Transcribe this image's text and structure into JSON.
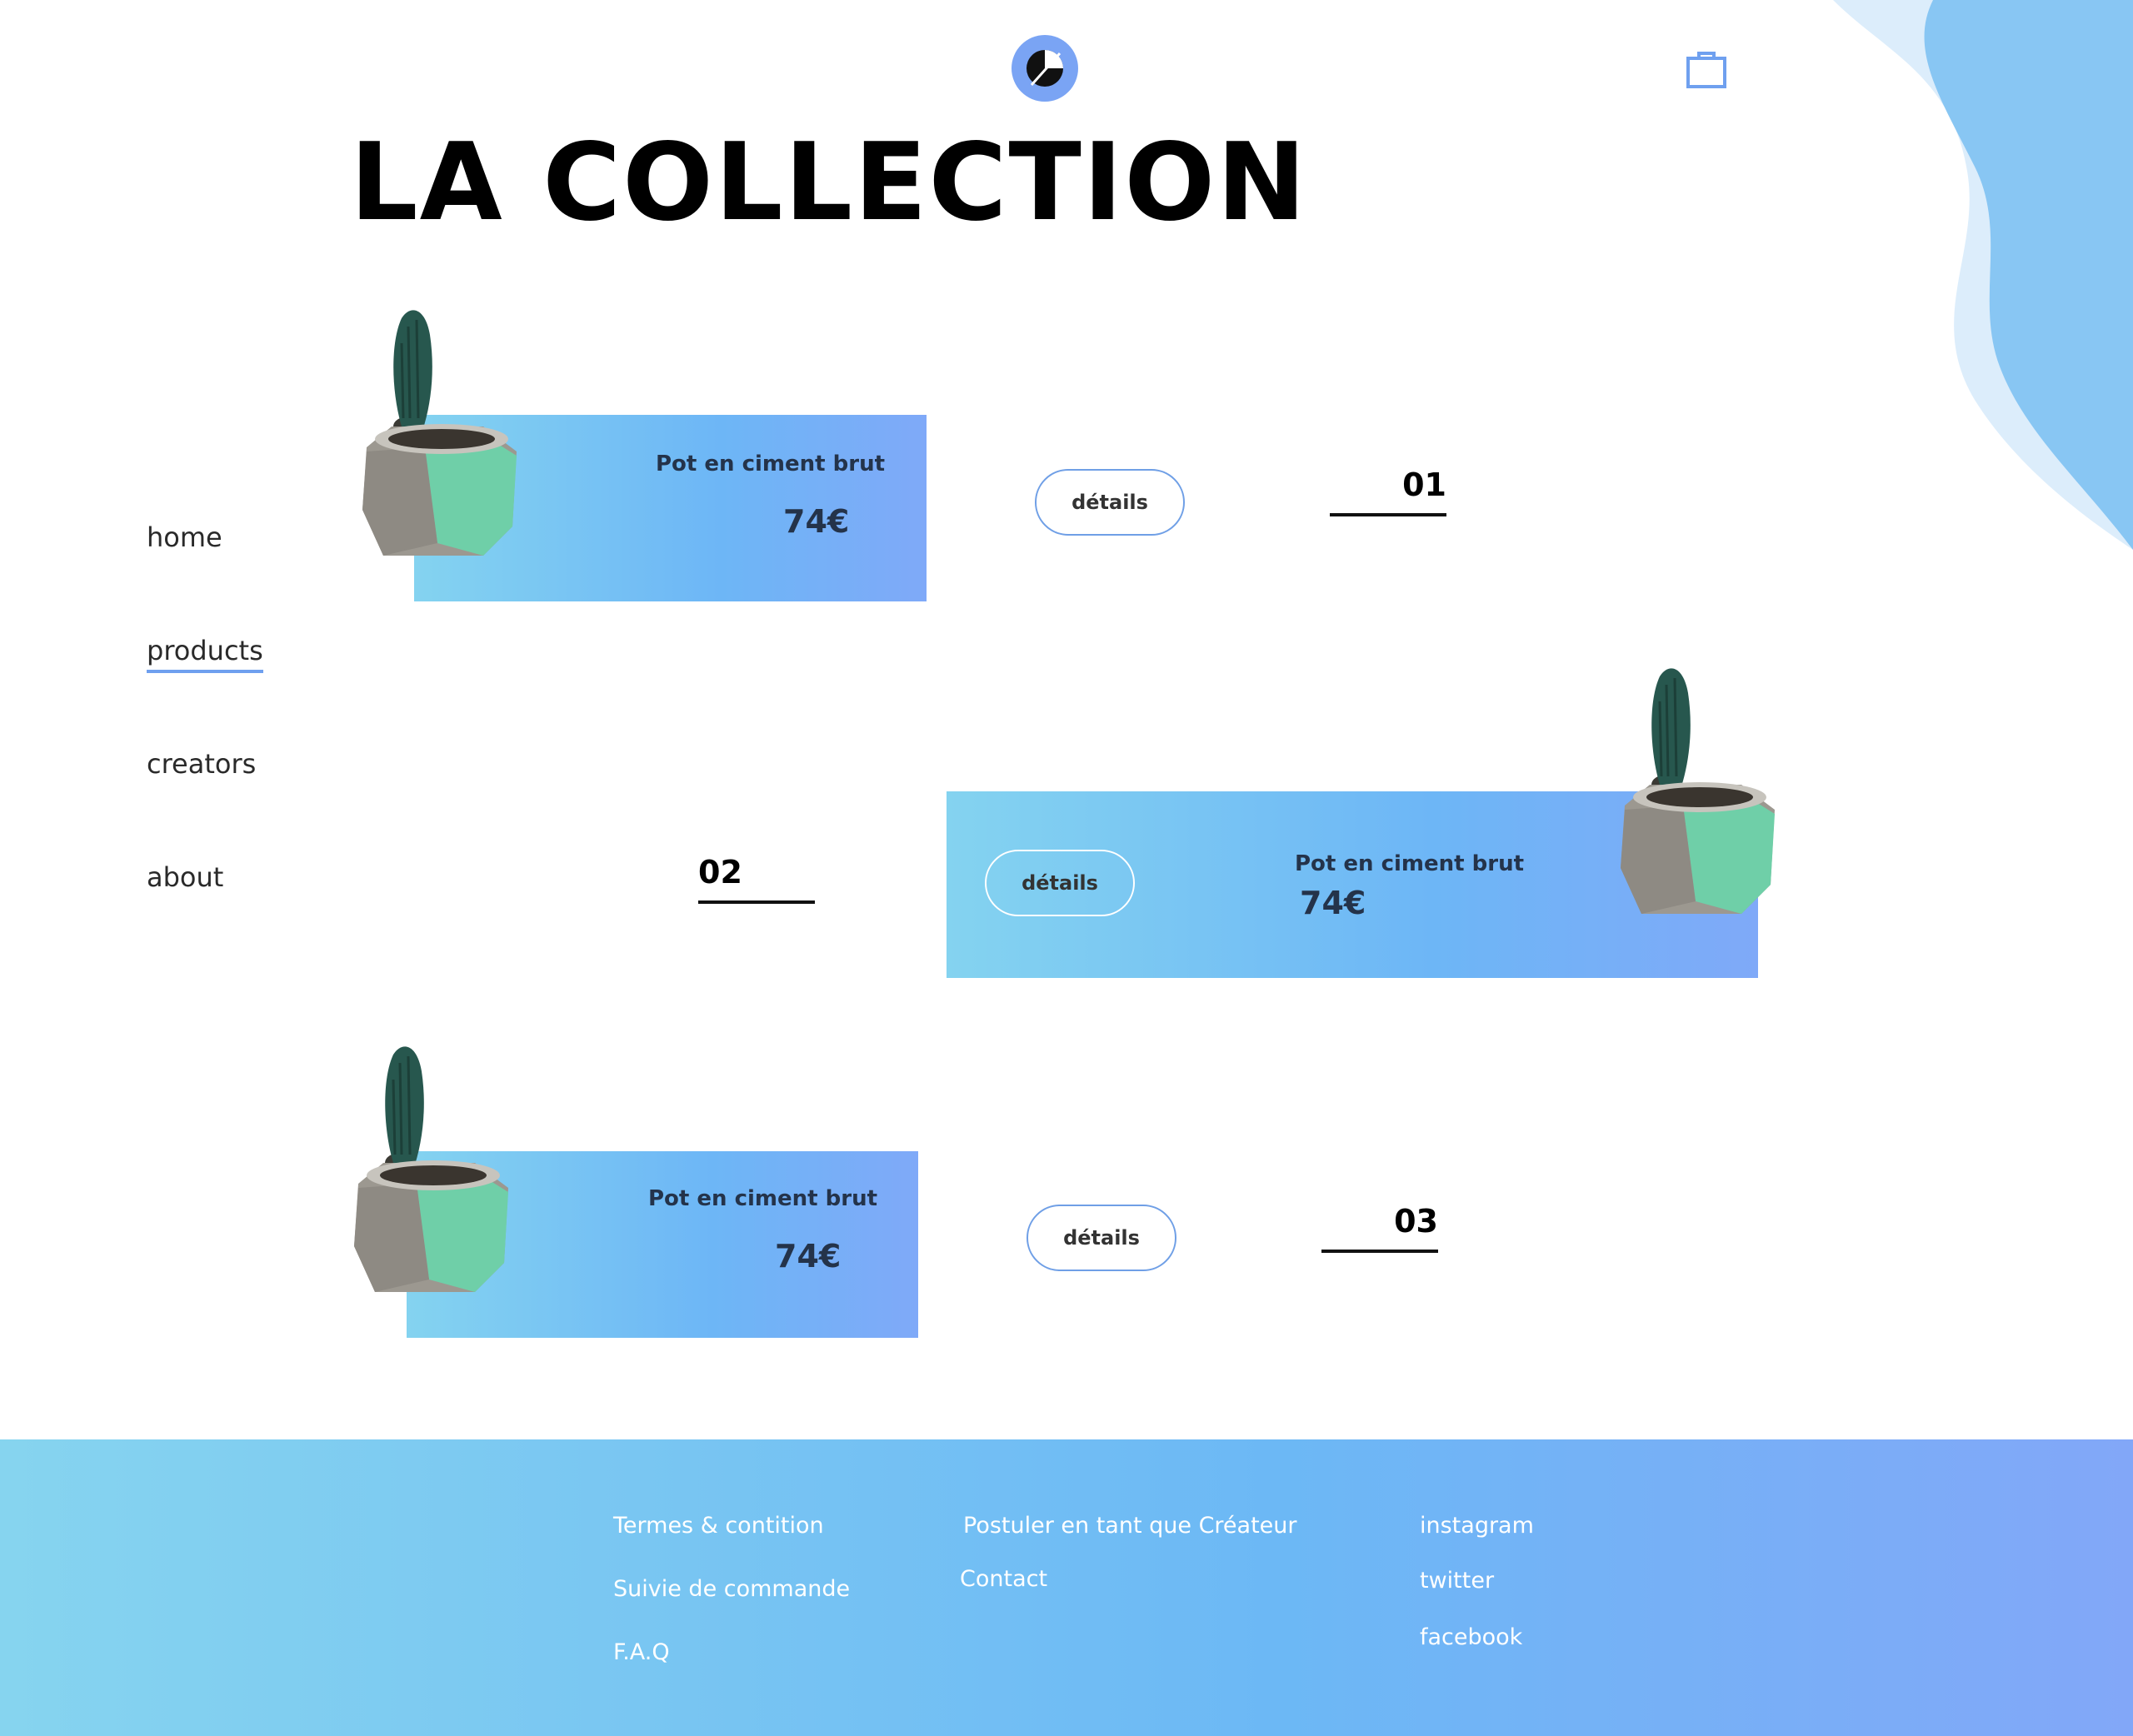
{
  "header": {
    "title": "LA COLLECTION",
    "logo_icon": "brand-logo-icon",
    "cart_icon": "shopping-bag-icon"
  },
  "nav": {
    "items": [
      {
        "label": "home"
      },
      {
        "label": "products",
        "active": true
      },
      {
        "label": "creators"
      },
      {
        "label": "about"
      }
    ]
  },
  "products": [
    {
      "name": "Pot en ciment brut",
      "price": "74€",
      "button": "détails",
      "number": "01"
    },
    {
      "name": "Pot en ciment brut",
      "price": "74€",
      "button": "détails",
      "number": "02"
    },
    {
      "name": "Pot en ciment brut",
      "price": "74€",
      "button": "détails",
      "number": "03"
    }
  ],
  "footer": {
    "col1": [
      "Termes & contition",
      "Suivie de commande",
      "F.A.Q"
    ],
    "col2": [
      "Postuler en tant que Créateur",
      "Contact"
    ],
    "col3": [
      "instagram",
      "twitter",
      "facebook"
    ]
  },
  "colors": {
    "accent": "#6fa0ef",
    "gradient_start": "#84d3f0",
    "gradient_end": "#7fa9f8",
    "text_dark": "#24334a"
  }
}
